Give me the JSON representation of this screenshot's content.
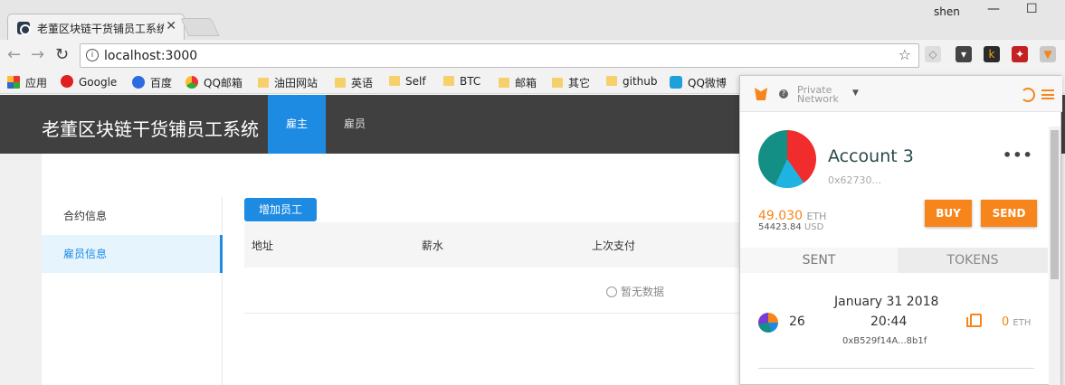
{
  "browser": {
    "tab_title": "老董区块链干货铺员工系统",
    "tab_close": "✕",
    "user": "shen",
    "minimize": "—",
    "maximize": "☐",
    "url": "localhost:3000",
    "bookmarks": [
      {
        "label": "应用",
        "icon": "apps-icon"
      },
      {
        "label": "Google",
        "icon": "google-icon"
      },
      {
        "label": "百度",
        "icon": "baidu-icon"
      },
      {
        "label": "QQ邮箱",
        "icon": "qqmail-icon"
      },
      {
        "label": "油田网站",
        "icon": "folder-icon"
      },
      {
        "label": "英语",
        "icon": "folder-icon"
      },
      {
        "label": "Self",
        "icon": "folder-icon"
      },
      {
        "label": "BTC",
        "icon": "folder-icon"
      },
      {
        "label": "邮箱",
        "icon": "folder-icon"
      },
      {
        "label": "其它",
        "icon": "folder-icon"
      },
      {
        "label": "github",
        "icon": "folder-icon"
      },
      {
        "label": "QQ微博",
        "icon": "weibo-icon"
      }
    ]
  },
  "app": {
    "title": "老董区块链干货铺员工系统",
    "nav": [
      {
        "label": "雇主"
      },
      {
        "label": "雇员"
      }
    ],
    "menu": [
      {
        "label": "合约信息"
      },
      {
        "label": "雇员信息"
      }
    ],
    "add_button": "增加员工",
    "columns": [
      "地址",
      "薪水",
      "上次支付"
    ],
    "empty_text": "暂无数据"
  },
  "metamask": {
    "network": "Private\nNetwork",
    "account_name": "Account 3",
    "account_address": "0x62730...",
    "more": "•••",
    "eth_balance": "49.030",
    "eth_unit": "ETH",
    "usd_balance": "54423.84",
    "usd_unit": "USD",
    "buy_label": "BUY",
    "send_label": "SEND",
    "tabs": [
      "SENT",
      "TOKENS"
    ],
    "tx": {
      "date": "January 31 2018",
      "time": "20:44",
      "nonce": "26",
      "hash": "0xB529f14A...8b1f",
      "value": "0",
      "unit": "ETH"
    }
  },
  "colors": {
    "accent": "#1e8be3",
    "header_bg": "#404040",
    "metamask_orange": "#f6851b"
  }
}
